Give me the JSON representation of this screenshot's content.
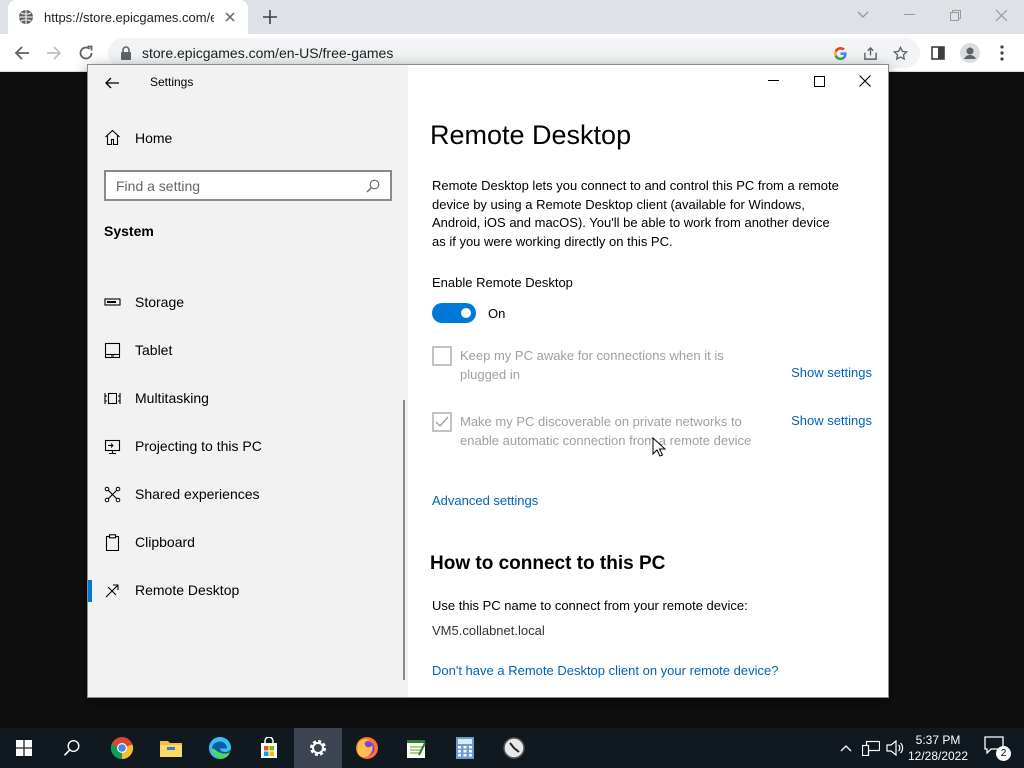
{
  "browser": {
    "tab_title": "https://store.epicgames.com/en-",
    "url": "store.epicgames.com/en-US/free-games"
  },
  "settings": {
    "app_title": "Settings",
    "home_label": "Home",
    "search_placeholder": "Find a setting",
    "section_title": "System",
    "nav_items": [
      {
        "label": "Storage",
        "icon": "storage-icon"
      },
      {
        "label": "Tablet",
        "icon": "tablet-icon"
      },
      {
        "label": "Multitasking",
        "icon": "multitasking-icon"
      },
      {
        "label": "Projecting to this PC",
        "icon": "projecting-icon"
      },
      {
        "label": "Shared experiences",
        "icon": "shared-experiences-icon"
      },
      {
        "label": "Clipboard",
        "icon": "clipboard-icon"
      },
      {
        "label": "Remote Desktop",
        "icon": "remote-desktop-icon",
        "selected": true
      }
    ],
    "page_title": "Remote Desktop",
    "description": "Remote Desktop lets you connect to and control this PC from a remote device by using a Remote Desktop client (available for Windows, Android, iOS and macOS). You'll be able to work from another device as if you were working directly on this PC.",
    "enable_label": "Enable Remote Desktop",
    "toggle_state": "On",
    "option_awake": {
      "text": "Keep my PC awake for connections when it is plugged in",
      "checked": false,
      "link": "Show settings"
    },
    "option_discoverable": {
      "text": "Make my PC discoverable on private networks to enable automatic connection from a remote device",
      "checked": true,
      "link": "Show settings"
    },
    "advanced_link": "Advanced settings",
    "how_to_title": "How to connect to this PC",
    "use_name_text": "Use this PC name to connect from your remote device:",
    "pc_name": "VM5.collabnet.local",
    "client_link": "Don't have a Remote Desktop client on your remote device?"
  },
  "taskbar": {
    "time": "5:37 PM",
    "date": "12/28/2022",
    "notification_count": "2"
  },
  "colors": {
    "accent": "#0078d7",
    "link": "#0063b1"
  }
}
